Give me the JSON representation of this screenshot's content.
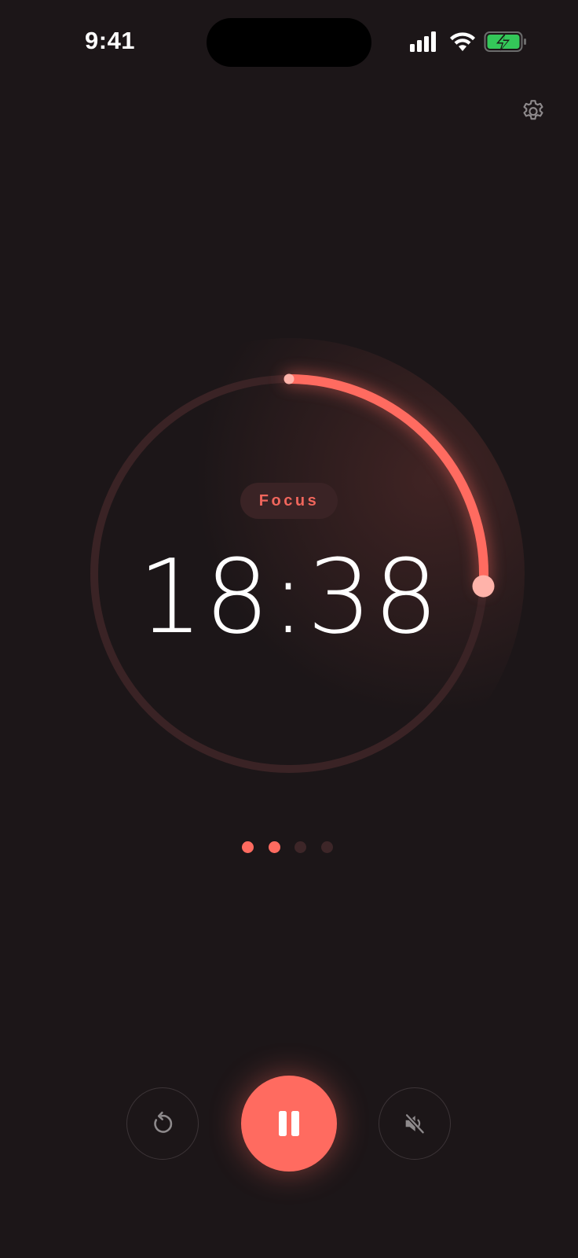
{
  "status_bar": {
    "time": "9:41",
    "icons": [
      "signal-icon",
      "wifi-icon",
      "battery-charging-icon"
    ]
  },
  "settings": {
    "icon": "gear-icon"
  },
  "timer": {
    "mode_label": "Focus",
    "time_remaining": "18:38",
    "progress_fraction": 0.26
  },
  "sessions": {
    "total": 4,
    "completed": 2
  },
  "controls": {
    "reset_icon": "reset-icon",
    "primary_icon": "pause-icon",
    "sound_icon": "mute-icon"
  },
  "colors": {
    "background": "#1c1618",
    "accent": "#ff6b60",
    "track": "#3a2325",
    "dot_inactive": "#3d2628",
    "battery_green": "#34c759"
  }
}
